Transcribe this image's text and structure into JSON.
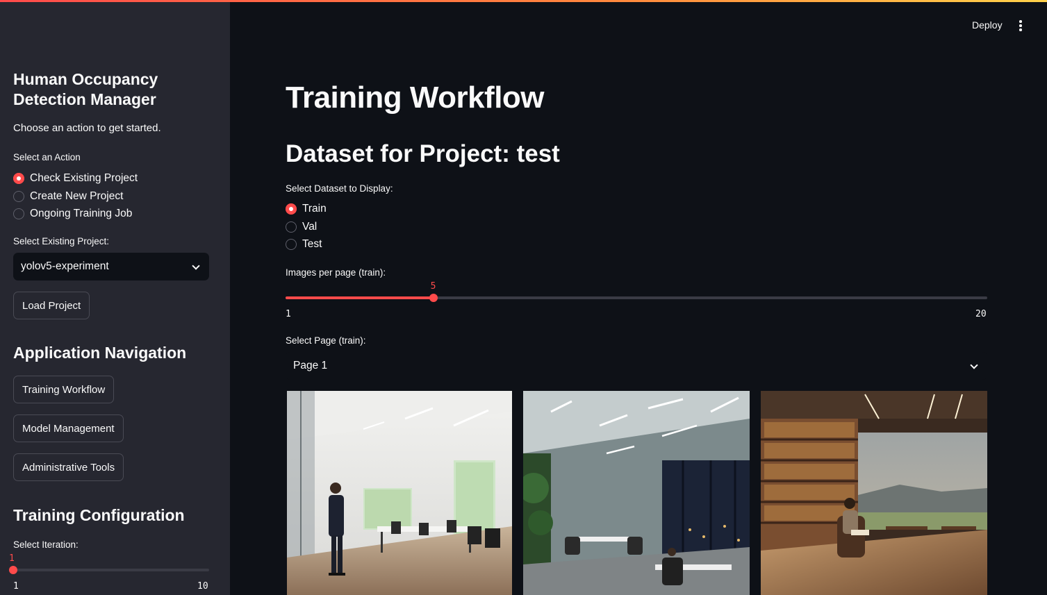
{
  "app": {
    "deploy_label": "Deploy",
    "menu_icon": "kebab-menu-icon",
    "accent_color": "#ff4b4b",
    "background_color": "#0e1117",
    "sidebar_color": "#262730"
  },
  "sidebar": {
    "title": "Human Occupancy Detection Manager",
    "subtitle": "Choose an action to get started.",
    "action_label": "Select an Action",
    "actions": [
      {
        "label": "Check Existing Project",
        "selected": true
      },
      {
        "label": "Create New Project",
        "selected": false
      },
      {
        "label": "Ongoing Training Job",
        "selected": false
      }
    ],
    "project_label": "Select Existing Project:",
    "project_value": "yolov5-experiment",
    "load_button": "Load Project",
    "nav_heading": "Application Navigation",
    "nav_buttons": [
      "Training Workflow",
      "Model Management",
      "Administrative Tools"
    ],
    "config_heading": "Training Configuration",
    "iteration_label": "Select Iteration:",
    "iteration_slider": {
      "value": "1",
      "min": "1",
      "max": "10",
      "fraction": 0.0
    }
  },
  "main": {
    "title": "Training Workflow",
    "dataset_heading": "Dataset for Project: test",
    "dataset_label": "Select Dataset to Display:",
    "datasets": [
      {
        "label": "Train",
        "selected": true
      },
      {
        "label": "Val",
        "selected": false
      },
      {
        "label": "Test",
        "selected": false
      }
    ],
    "per_page_label": "Images per page (train):",
    "per_page_slider": {
      "value": "5",
      "min": "1",
      "max": "20",
      "fraction": 0.2105
    },
    "page_label": "Select Page (train):",
    "page_value": "Page 1",
    "images": [
      {
        "scene": "office-man-standing"
      },
      {
        "scene": "meeting-room-night"
      },
      {
        "scene": "library-person-reading"
      }
    ]
  }
}
